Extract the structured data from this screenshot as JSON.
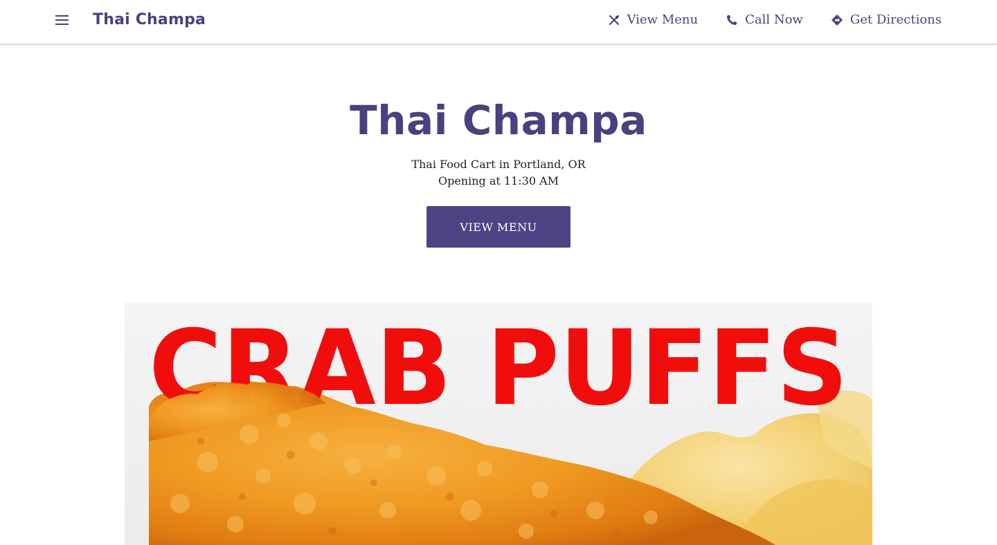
{
  "header": {
    "brand": "Thai Champa",
    "menu_icon": "hamburger-menu-icon",
    "actions": [
      {
        "label": "View Menu",
        "icon": "utensils-icon"
      },
      {
        "label": "Call Now",
        "icon": "phone-icon"
      },
      {
        "label": "Get Directions",
        "icon": "directions-icon"
      }
    ]
  },
  "hero": {
    "title": "Thai Champa",
    "subtitle": "Thai Food Cart in Portland, OR",
    "hours": "Opening at 11:30 AM",
    "cta_label": "VIEW MENU"
  },
  "banner": {
    "text": "CRAB PUFFS"
  },
  "colors": {
    "brand": "#4a4180",
    "button": "#4d4485",
    "banner_text": "#f20d0d"
  }
}
